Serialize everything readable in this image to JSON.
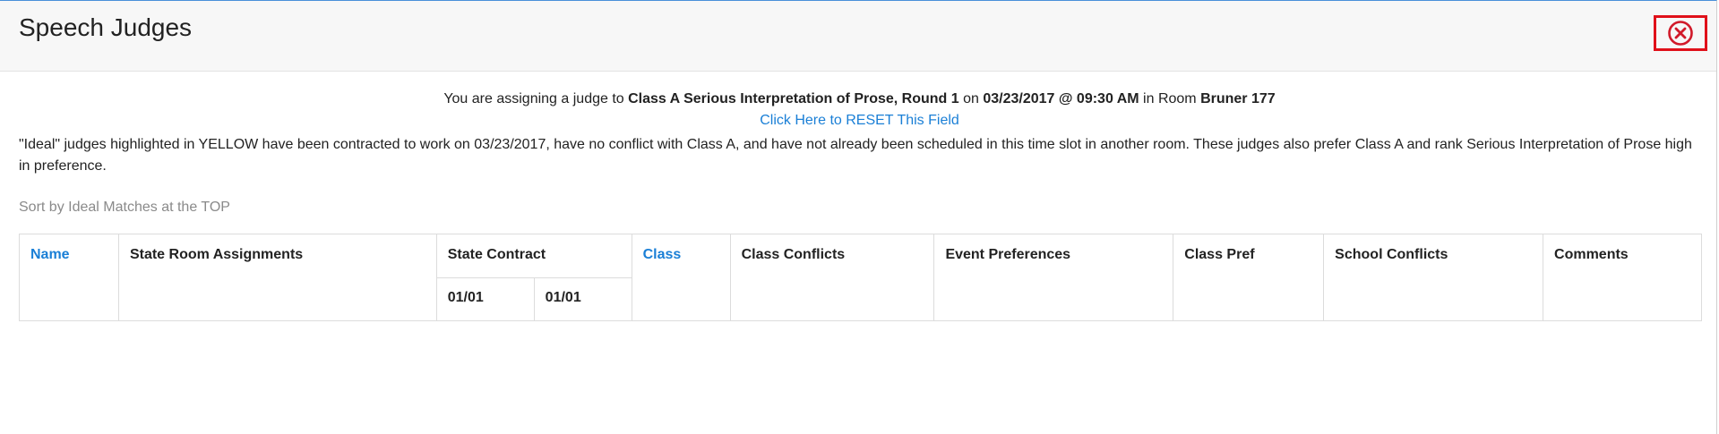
{
  "modal": {
    "title": "Speech Judges",
    "close_icon": "close-circle-icon",
    "accent_close_border": "#e0101a"
  },
  "assignment": {
    "prefix": "You are assigning a judge to ",
    "event": "Class A Serious Interpretation of Prose, Round 1",
    "on_text": " on ",
    "datetime": "03/23/2017 @ 09:30 AM",
    "room_text": " in Room ",
    "room": "Bruner 177"
  },
  "reset_link": "Click Here to RESET This Field",
  "ideal_note": "\"Ideal\" judges highlighted in YELLOW have been contracted to work on 03/23/2017, have no conflict with Class A, and have not already been scheduled in this time slot in another room. These judges also prefer Class A and rank Serious Interpretation of Prose high in preference.",
  "sort_label": "Sort by Ideal Matches at the TOP",
  "table": {
    "headers": {
      "name": "Name",
      "state_room": "State Room Assignments",
      "state_contract": "State Contract",
      "class": "Class",
      "class_conflicts": "Class Conflicts",
      "event_prefs": "Event Preferences",
      "class_pref": "Class Pref",
      "school_conflicts": "School Conflicts",
      "comments": "Comments"
    },
    "contract_dates": [
      "01/01",
      "01/01"
    ]
  },
  "colors": {
    "link": "#1a7fd6",
    "header_bg": "#f7f7f7"
  }
}
